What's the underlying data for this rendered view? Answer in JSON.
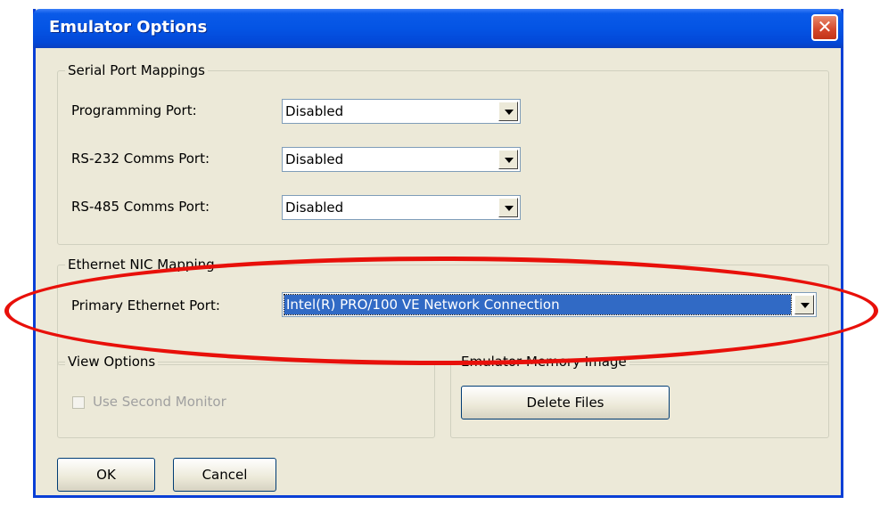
{
  "window": {
    "title": "Emulator Options",
    "close_glyph": "✕"
  },
  "serial": {
    "legend": "Serial Port Mappings",
    "rows": [
      {
        "label": "Programming Port:",
        "value": "Disabled"
      },
      {
        "label": "RS-232 Comms Port:",
        "value": "Disabled"
      },
      {
        "label": "RS-485 Comms Port:",
        "value": "Disabled"
      }
    ]
  },
  "ethernet": {
    "legend": "Ethernet NIC Mapping",
    "label": "Primary Ethernet Port:",
    "value": "Intel(R) PRO/100 VE Network Connection"
  },
  "view": {
    "legend": "View Options",
    "checkbox_label": "Use Second Monitor",
    "checked": false
  },
  "memory": {
    "legend": "Emulator Memory Image",
    "button": "Delete Files"
  },
  "buttons": {
    "ok": "OK",
    "cancel": "Cancel"
  },
  "colors": {
    "title_bar": "#0454e4",
    "highlight": "#316ac5",
    "annotation": "#e8100a",
    "dialog_bg": "#ece9d8"
  },
  "icons": {
    "close": "close-icon",
    "dropdown": "chevron-down-icon"
  }
}
